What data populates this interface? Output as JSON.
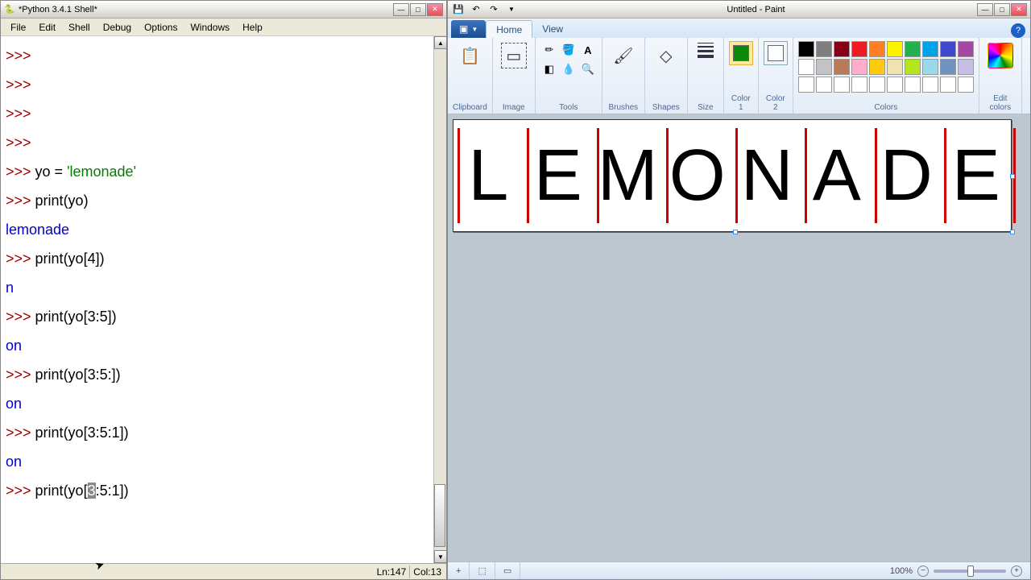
{
  "python": {
    "title": "*Python 3.4.1 Shell*",
    "menus": [
      "File",
      "Edit",
      "Shell",
      "Debug",
      "Options",
      "Windows",
      "Help"
    ],
    "status": {
      "ln_label": "Ln:",
      "ln": "147",
      "col_label": "Col:",
      "col": "13"
    },
    "lines": [
      {
        "type": "prompt",
        "text": ">>> "
      },
      {
        "type": "prompt",
        "text": ">>> "
      },
      {
        "type": "prompt",
        "text": ">>> "
      },
      {
        "type": "prompt",
        "text": ">>> "
      },
      {
        "type": "input",
        "code": "yo = ",
        "string": "'lemonade'"
      },
      {
        "type": "input",
        "code": "print(yo)"
      },
      {
        "type": "output",
        "text": "lemonade"
      },
      {
        "type": "input",
        "code": "print(yo[4])"
      },
      {
        "type": "output",
        "text": "n"
      },
      {
        "type": "input",
        "code": "print(yo[3:5])"
      },
      {
        "type": "output",
        "text": "on"
      },
      {
        "type": "input",
        "code": "print(yo[3:5:])"
      },
      {
        "type": "output",
        "text": "on"
      },
      {
        "type": "input",
        "code": "print(yo[3:5:1])"
      },
      {
        "type": "output",
        "text": "on"
      },
      {
        "type": "input-cursor",
        "pre": "print(yo[",
        "sel": "3",
        "post": ":5:1])"
      }
    ]
  },
  "paint": {
    "title": "Untitled - Paint",
    "tabs": {
      "home": "Home",
      "view": "View"
    },
    "groups": {
      "clipboard": "Clipboard",
      "image": "Image",
      "tools": "Tools",
      "brushes": "Brushes",
      "shapes": "Shapes",
      "size": "Size",
      "color1": "Color\n1",
      "color2": "Color\n2",
      "colors": "Colors",
      "edit_colors": "Edit\ncolors"
    },
    "color1": "#0a8a0a",
    "color2": "#ffffff",
    "palette": [
      "#000000",
      "#7f7f7f",
      "#880015",
      "#ed1c24",
      "#ff7f27",
      "#fff200",
      "#22b14c",
      "#00a2e8",
      "#3f48cc",
      "#a349a4",
      "#ffffff",
      "#c3c3c3",
      "#b97a57",
      "#ffaec9",
      "#ffc90e",
      "#efe4b0",
      "#b5e61d",
      "#99d9ea",
      "#7092be",
      "#c8bfe7",
      "#ffffff",
      "#ffffff",
      "#ffffff",
      "#ffffff",
      "#ffffff",
      "#ffffff",
      "#ffffff",
      "#ffffff",
      "#ffffff",
      "#ffffff"
    ],
    "canvas_text": "LEMONADE",
    "status": {
      "coord_icon": "+",
      "zoom": "100%"
    }
  }
}
